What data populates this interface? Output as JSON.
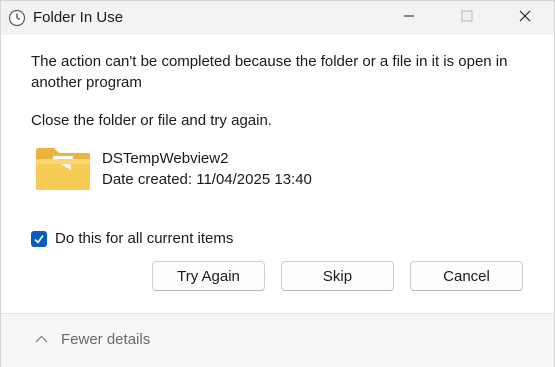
{
  "window": {
    "title": "Folder In Use",
    "title_icon": "clock-icon"
  },
  "message": {
    "text": "The action can't be completed because the folder or a file in it is open in another program",
    "instruction": "Close the folder or file and try again."
  },
  "file": {
    "icon": "folder-icon",
    "name": "DSTempWebview2",
    "date_created": "Date created: 11/04/2025 13:40"
  },
  "apply_all": {
    "label": "Do this for all current items",
    "checked": true
  },
  "buttons": {
    "try_again": "Try Again",
    "skip": "Skip",
    "cancel": "Cancel"
  },
  "footer": {
    "toggle_label": "Fewer details",
    "toggle_icon": "chevron-up-icon"
  },
  "colors": {
    "accent": "#0a5dba",
    "folder": "#f4c542",
    "titlebar": "#f3f3f3"
  }
}
